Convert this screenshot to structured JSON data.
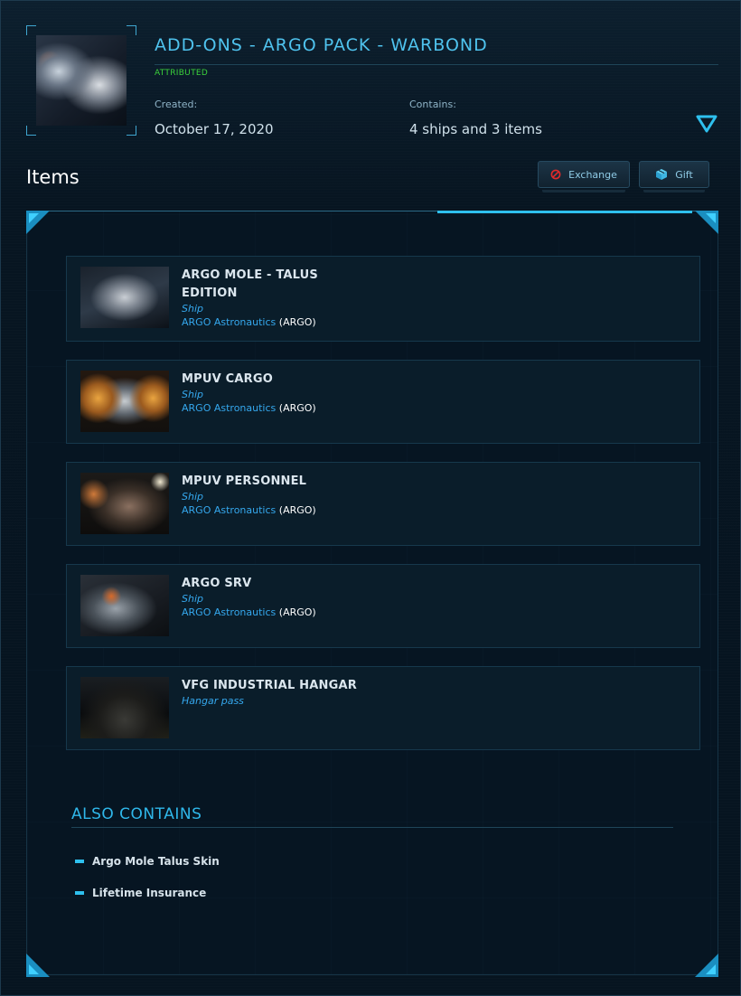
{
  "header": {
    "title": "ADD-ONS - ARGO PACK - WARBOND",
    "status": "ATTRIBUTED",
    "created_label": "Created:",
    "created_value": "October 17, 2020",
    "contains_label": "Contains:",
    "contains_value": "4 ships and 3 items"
  },
  "items_section": {
    "heading": "Items",
    "exchange_label": "Exchange",
    "gift_label": "Gift"
  },
  "items": [
    {
      "name_line1": "ARGO MOLE - TALUS",
      "name_line2": "EDITION",
      "type": "Ship",
      "maker": "ARGO Astronautics",
      "maker_code": "ARGO"
    },
    {
      "name_line1": "MPUV CARGO",
      "name_line2": "",
      "type": "Ship",
      "maker": "ARGO Astronautics",
      "maker_code": "ARGO"
    },
    {
      "name_line1": "MPUV PERSONNEL",
      "name_line2": "",
      "type": "Ship",
      "maker": "ARGO Astronautics",
      "maker_code": "ARGO"
    },
    {
      "name_line1": "ARGO SRV",
      "name_line2": "",
      "type": "Ship",
      "maker": "ARGO Astronautics",
      "maker_code": "ARGO"
    },
    {
      "name_line1": "VFG INDUSTRIAL HANGAR",
      "name_line2": "",
      "type": "Hangar pass",
      "maker": "",
      "maker_code": ""
    }
  ],
  "also_contains": {
    "title": "ALSO CONTAINS",
    "entries": [
      "Argo Mole Talus Skin",
      "Lifetime Insurance"
    ]
  },
  "colors": {
    "accent": "#2ec0ee",
    "title": "#4fc3ee",
    "attributed": "#3bd23b",
    "background": "#071521"
  },
  "icons": {
    "expand": "chevron-down-triangle-icon",
    "exchange": "no-entry-icon",
    "gift": "gift-box-icon"
  }
}
